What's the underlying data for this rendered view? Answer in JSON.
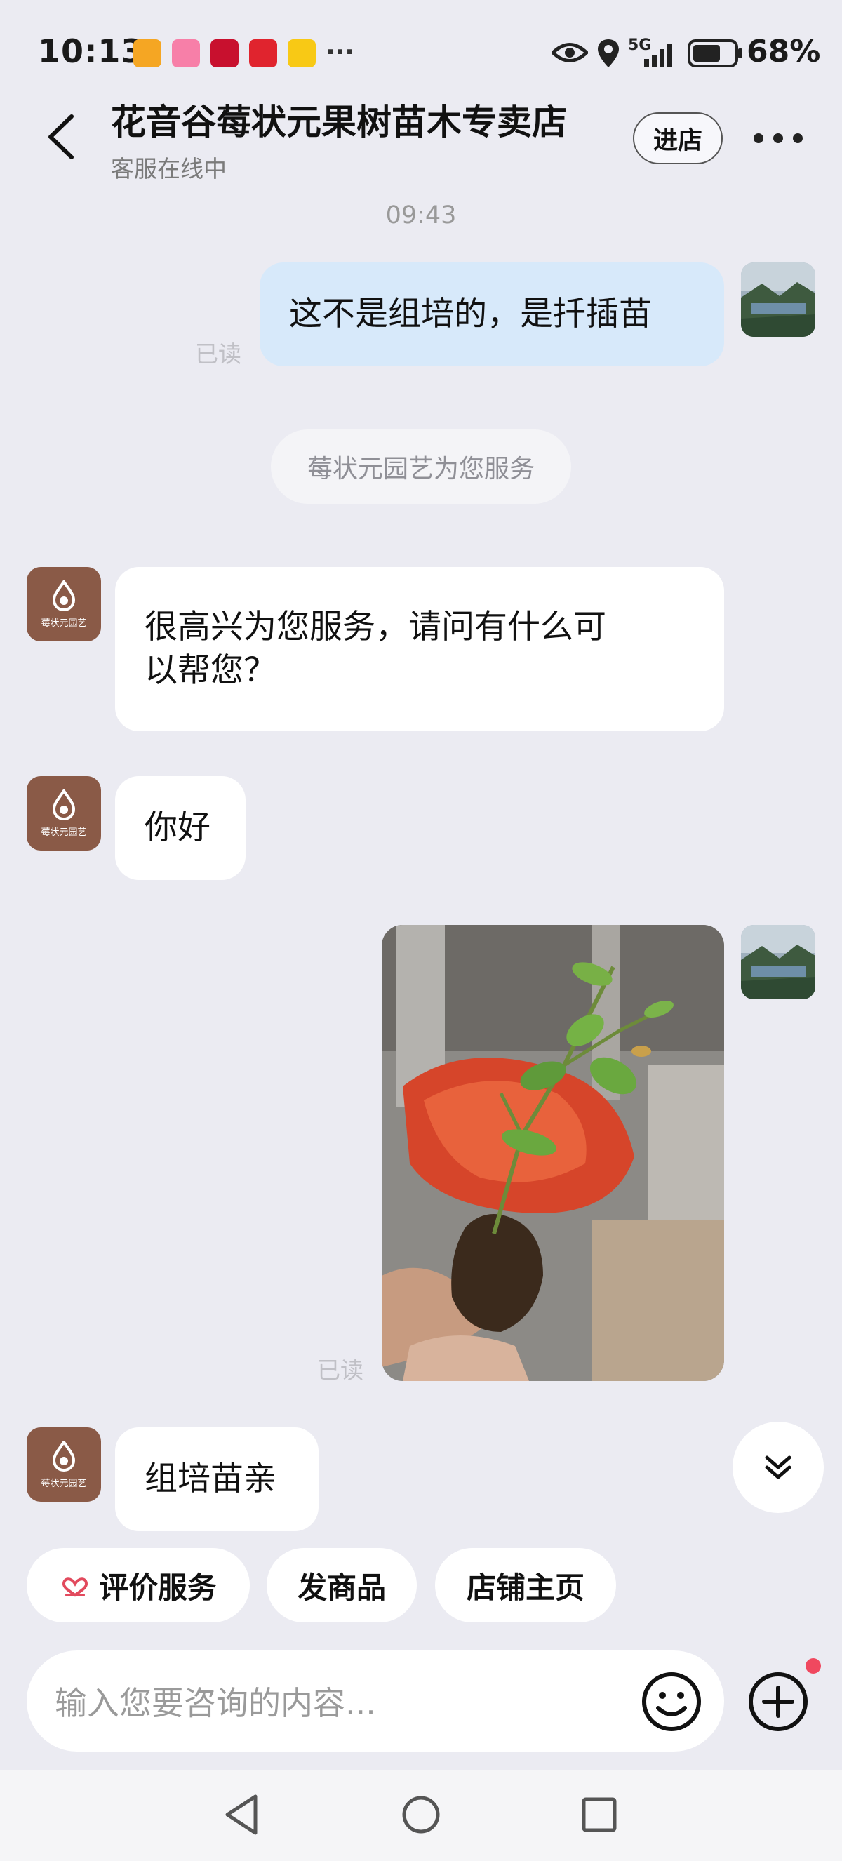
{
  "status_bar": {
    "time": "10:13",
    "overflow": "···",
    "network": "5G",
    "battery": "68%",
    "notification_icons": [
      "orange-badge-icon",
      "pink-app-icon",
      "tmall-icon",
      "red-app-icon",
      "yellow-app-icon"
    ]
  },
  "header": {
    "title": "花音谷莓状元果树苗木专卖店",
    "subtitle": "客服在线中",
    "enter_label": "进店"
  },
  "chat": {
    "timestamp": "09:43",
    "messages": [
      {
        "from": "me",
        "text": "这不是组培的，是扦插苗",
        "status": "已读"
      },
      {
        "from": "system",
        "text": "莓状元园艺为您服务"
      },
      {
        "from": "shop",
        "line1": "很高兴为您服务，请问有什么可",
        "line2": "以帮您？"
      },
      {
        "from": "shop",
        "text": "你好"
      },
      {
        "from": "me",
        "type": "image",
        "status": "已读"
      },
      {
        "from": "shop",
        "text": "组培苗亲"
      }
    ],
    "shop_avatar_label": "莓状元园艺"
  },
  "quick_actions": [
    "评价服务",
    "发商品",
    "店铺主页"
  ],
  "input": {
    "placeholder": "输入您要咨询的内容..."
  },
  "colors": {
    "background": "#ebebf2",
    "outgoing_bubble": "#d7e9fa",
    "shop_avatar": "#8a5a47",
    "badge": "#f0485f"
  }
}
